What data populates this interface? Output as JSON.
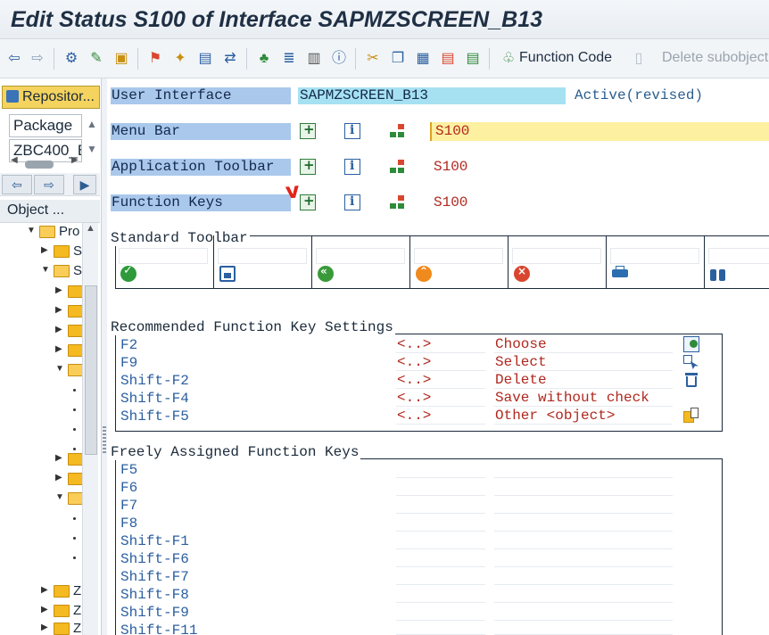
{
  "window": {
    "title": "Edit Status S100 of Interface SAPMZSCREEN_B13"
  },
  "toolbar": {
    "function_code_label": "Function Code",
    "delete_subobject_label": "Delete subobject"
  },
  "left_panel": {
    "repository_button": "Repositor...",
    "object_type_value": "Package",
    "object_name_value": "ZBC400_B",
    "column_header": "Object ...",
    "tree": [
      {
        "label": "Pro"
      },
      {
        "label": "S"
      },
      {
        "label": "S"
      },
      {
        "label": "Z"
      },
      {
        "label": "Z"
      },
      {
        "label": "Z"
      }
    ]
  },
  "interface": {
    "label": "User Interface",
    "program": "SAPMZSCREEN_B13",
    "status": "Active(revised)"
  },
  "rows": [
    {
      "label": "Menu Bar",
      "value": "S100"
    },
    {
      "label": "Application Toolbar",
      "value": "S100"
    },
    {
      "label": "Function Keys",
      "value": "S100"
    }
  ],
  "annotation": {
    "mark": "v"
  },
  "standard_toolbar": {
    "title": "Standard Toolbar",
    "icons": [
      "check-icon",
      "save-icon",
      "back-icon",
      "exit-icon",
      "cancel-icon",
      "print-icon",
      "find-icon"
    ],
    "colors": {
      "check": "#2e9a3a",
      "save": "#2b5fa0",
      "back": "#3a9a3a",
      "exit": "#f08a1c",
      "cancel": "#d9462f",
      "print": "#2b6fb0",
      "find": "#2b5fa0"
    }
  },
  "recommended": {
    "title": "Recommended Function Key Settings",
    "rows": [
      {
        "key": "F2",
        "code": "<..>",
        "text": "Choose",
        "icon": "choose-icon"
      },
      {
        "key": "F9",
        "code": "<..>",
        "text": "Select",
        "icon": "select-icon"
      },
      {
        "key": "Shift-F2",
        "code": "<..>",
        "text": "Delete",
        "icon": "trash-icon"
      },
      {
        "key": "Shift-F4",
        "code": "<..>",
        "text": "Save without check",
        "icon": ""
      },
      {
        "key": "Shift-F5",
        "code": "<..>",
        "text": "Other <object>",
        "icon": "other-object-icon"
      }
    ]
  },
  "freely_assigned": {
    "title": "Freely Assigned Function Keys",
    "keys": [
      "F5",
      "F6",
      "F7",
      "F8",
      "Shift-F1",
      "Shift-F6",
      "Shift-F7",
      "Shift-F8",
      "Shift-F9",
      "Shift-F11"
    ]
  }
}
